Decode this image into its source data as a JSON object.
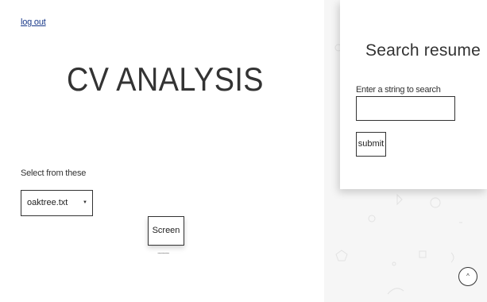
{
  "header": {
    "logout_label": "log out"
  },
  "main": {
    "title": "CV ANALYSIS",
    "select_label": "Select from these",
    "selected_file": "oaktree.txt",
    "screen_button": "Screen",
    "squiggle": "~~~"
  },
  "search": {
    "title": "Search resume",
    "input_label": "Enter a string to search",
    "input_value": "",
    "submit_label": "submit"
  },
  "scroll_top": {
    "icon": "chevron-up-icon",
    "glyph": "^"
  }
}
